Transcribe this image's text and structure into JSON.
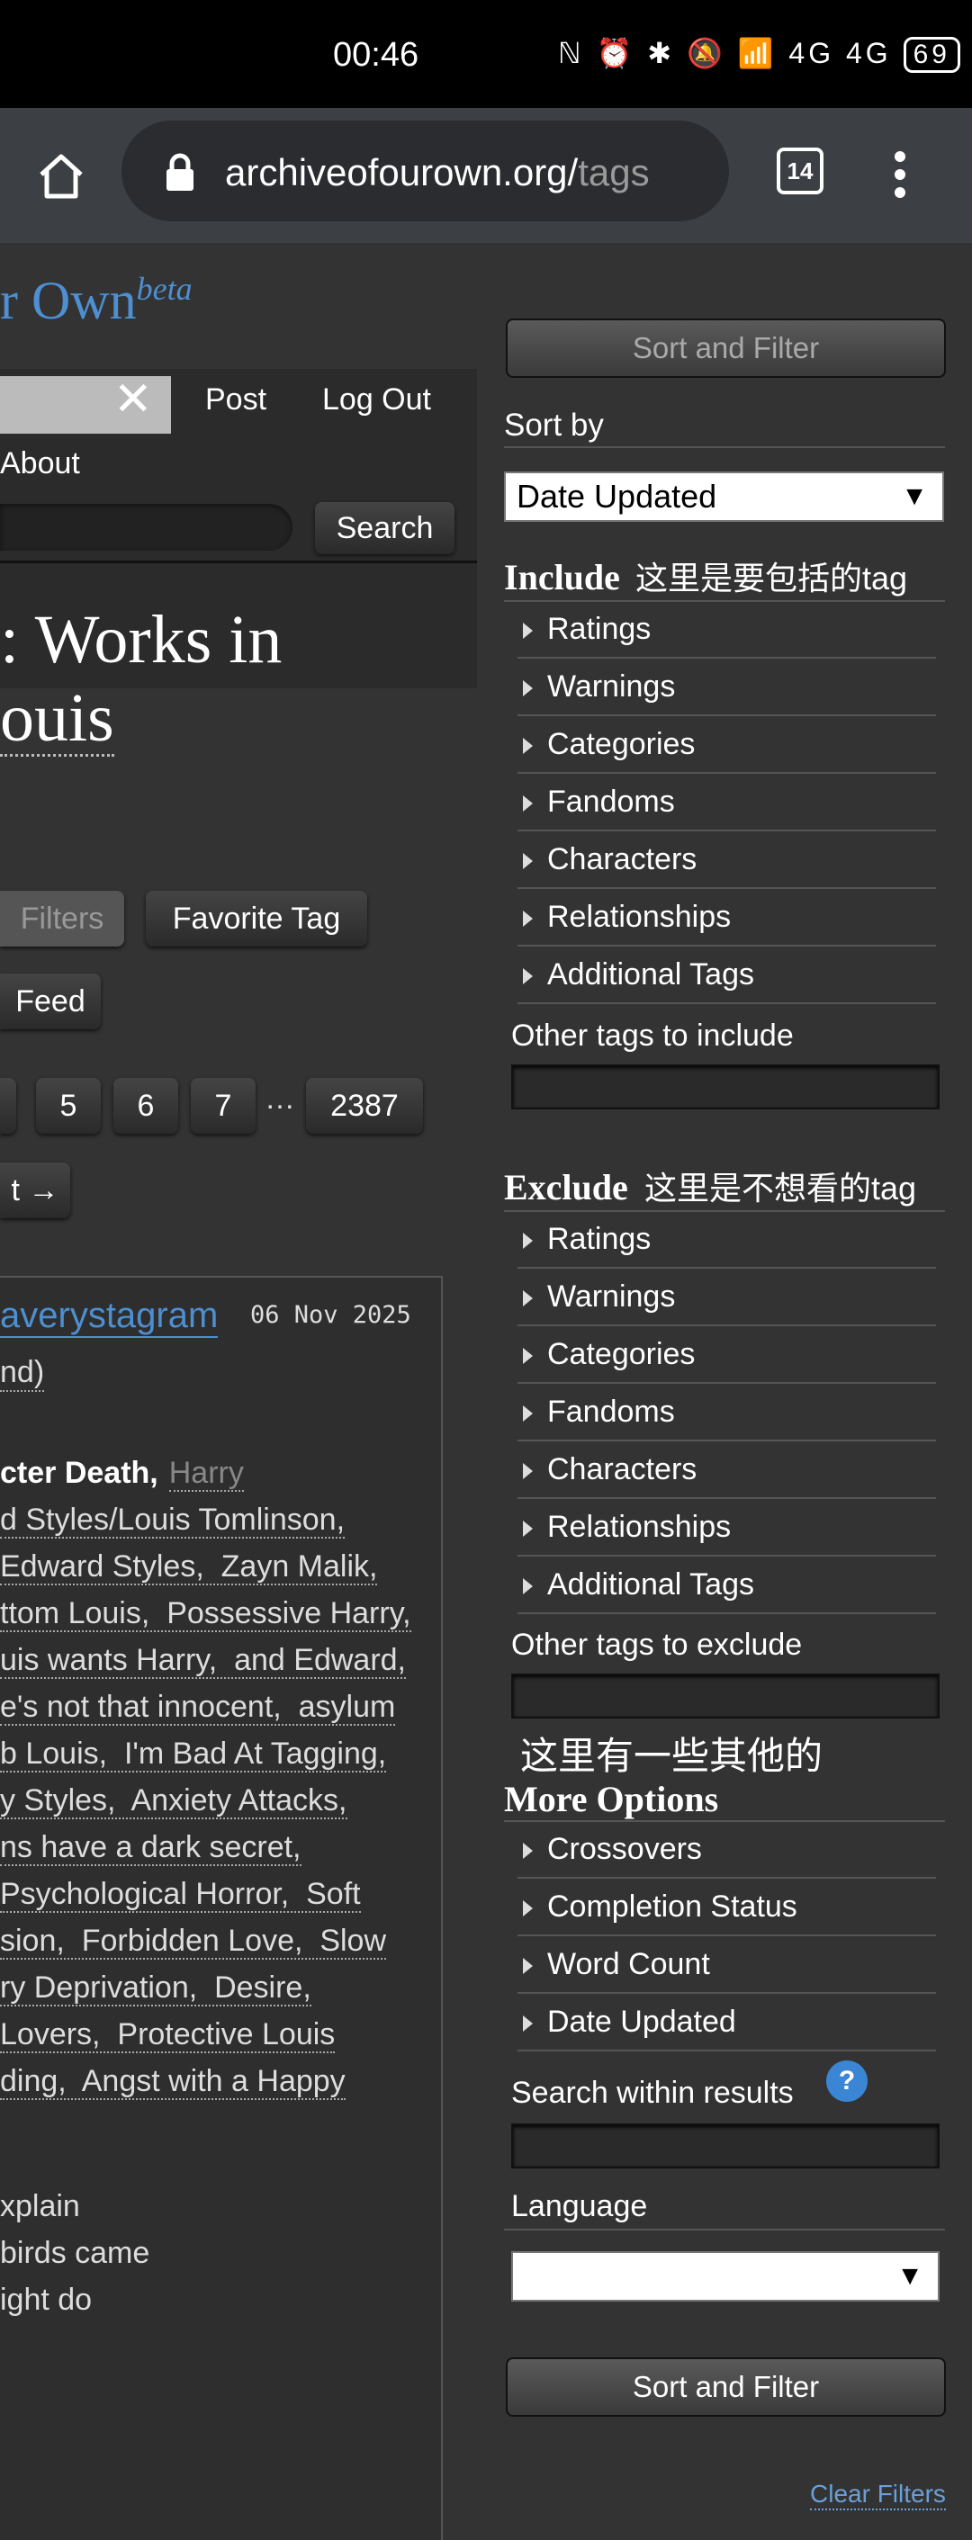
{
  "status_bar": {
    "time": "00:46",
    "icons_text": "ℕ ⏰ ✱ 🔕 📶 4G 4G",
    "battery": "69"
  },
  "browser": {
    "url_main": "archiveofourown.org/",
    "url_dim": "tags",
    "tab_count": "14"
  },
  "header": {
    "logo_text": "r Own",
    "logo_sup": "beta",
    "nav_post": "Post",
    "nav_logout": "Log Out",
    "nav_about": "About",
    "search_button": "Search"
  },
  "main": {
    "heading_line1": "Works in",
    "heading_line2": "ouis",
    "filters_button": "Filters",
    "favorite_tag_button": "Favorite Tag",
    "feed_button": "Feed",
    "pagination": [
      "5",
      "6",
      "7",
      "…",
      "2387"
    ],
    "next_label": "t →",
    "work": {
      "author": "averystagram",
      "date": "06 Nov 2025",
      "fandom_tail": "nd)",
      "tag_lines": [
        {
          "bold": "cter Death,",
          "grey": "Harry"
        },
        {
          "text": "d Styles/Louis Tomlinson,"
        },
        {
          "text": "Edward Styles,  Zayn Malik,"
        },
        {
          "text": "ttom Louis,  Possessive Harry,"
        },
        {
          "text": "uis wants Harry,  and Edward,"
        },
        {
          "text": "e's not that innocent,  asylum"
        },
        {
          "text": "b Louis,  I'm Bad At Tagging,"
        },
        {
          "text": "y Styles,  Anxiety Attacks,"
        },
        {
          "text": "ns have a dark secret,"
        },
        {
          "text": "Psychological Horror,  Soft"
        },
        {
          "text": "sion,  Forbidden Love,  Slow"
        },
        {
          "text": "ry Deprivation,  Desire,"
        },
        {
          "text": "Lovers,  Protective Louis"
        },
        {
          "text": "ding,  Angst with a Happy"
        }
      ],
      "summary_lines": [
        "xplain",
        "birds came",
        "ight do"
      ]
    }
  },
  "sidebar": {
    "top_button": "Sort and Filter",
    "sort_by_label": "Sort by",
    "sort_by_value": "Date Updated",
    "include_title": "Include",
    "include_annotation": "这里是要包括的tag",
    "include_items": [
      "Ratings",
      "Warnings",
      "Categories",
      "Fandoms",
      "Characters",
      "Relationships",
      "Additional Tags"
    ],
    "other_include_label": "Other tags to include",
    "exclude_title": "Exclude",
    "exclude_annotation": "这里是不想看的tag",
    "exclude_items": [
      "Ratings",
      "Warnings",
      "Categories",
      "Fandoms",
      "Characters",
      "Relationships",
      "Additional Tags"
    ],
    "other_exclude_label": "Other tags to exclude",
    "more_annotation": "这里有一些其他的",
    "more_title": "More Options",
    "more_items": [
      "Crossovers",
      "Completion Status",
      "Word Count",
      "Date Updated"
    ],
    "search_within_label": "Search within results",
    "help_icon_text": "?",
    "language_label": "Language",
    "language_value": "",
    "bottom_button": "Sort and Filter",
    "clear_filters": "Clear Filters"
  },
  "colors": {
    "accent_link": "#4d8fd0",
    "page_bg": "#333333",
    "help_blue": "#3a86d4"
  }
}
